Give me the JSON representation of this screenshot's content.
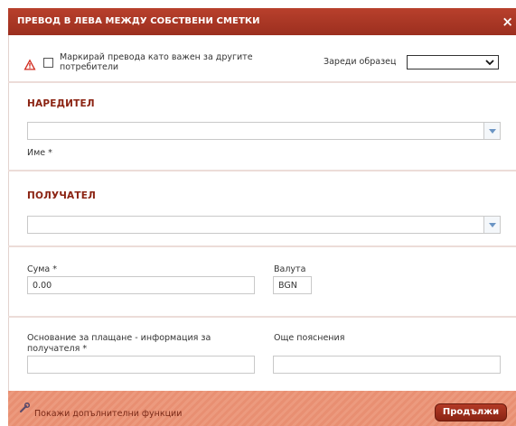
{
  "dialog": {
    "title": "ПРЕВОД В ЛЕВА МЕЖДУ СОБСТВЕНИ СМЕТКИ",
    "close_label": "×"
  },
  "options": {
    "mark_important_label": "Маркирай превода като важен за другите потребители",
    "mark_important_checked": false,
    "load_template_label": "Зареди образец",
    "load_template_value": ""
  },
  "payer": {
    "section_title": "НАРЕДИТЕЛ",
    "name_label": "Име *",
    "name_value": ""
  },
  "payee": {
    "section_title": "ПОЛУЧАТЕЛ",
    "account_value": ""
  },
  "amount": {
    "label": "Сума *",
    "value": "0.00",
    "currency_label": "Валута",
    "currency_value": "BGN"
  },
  "reason": {
    "label": "Основание за плащане - информация за получателя *",
    "value": "",
    "notes_label": "Още пояснения",
    "notes_value": ""
  },
  "footer": {
    "more_functions_label": "Покажи допълнителни функции",
    "continue_label": "Продължи"
  },
  "colors": {
    "title_bar": "#a8372a",
    "section_title": "#8b2312",
    "footer": "#ea9478",
    "accent_button": "#9c2f1f"
  }
}
